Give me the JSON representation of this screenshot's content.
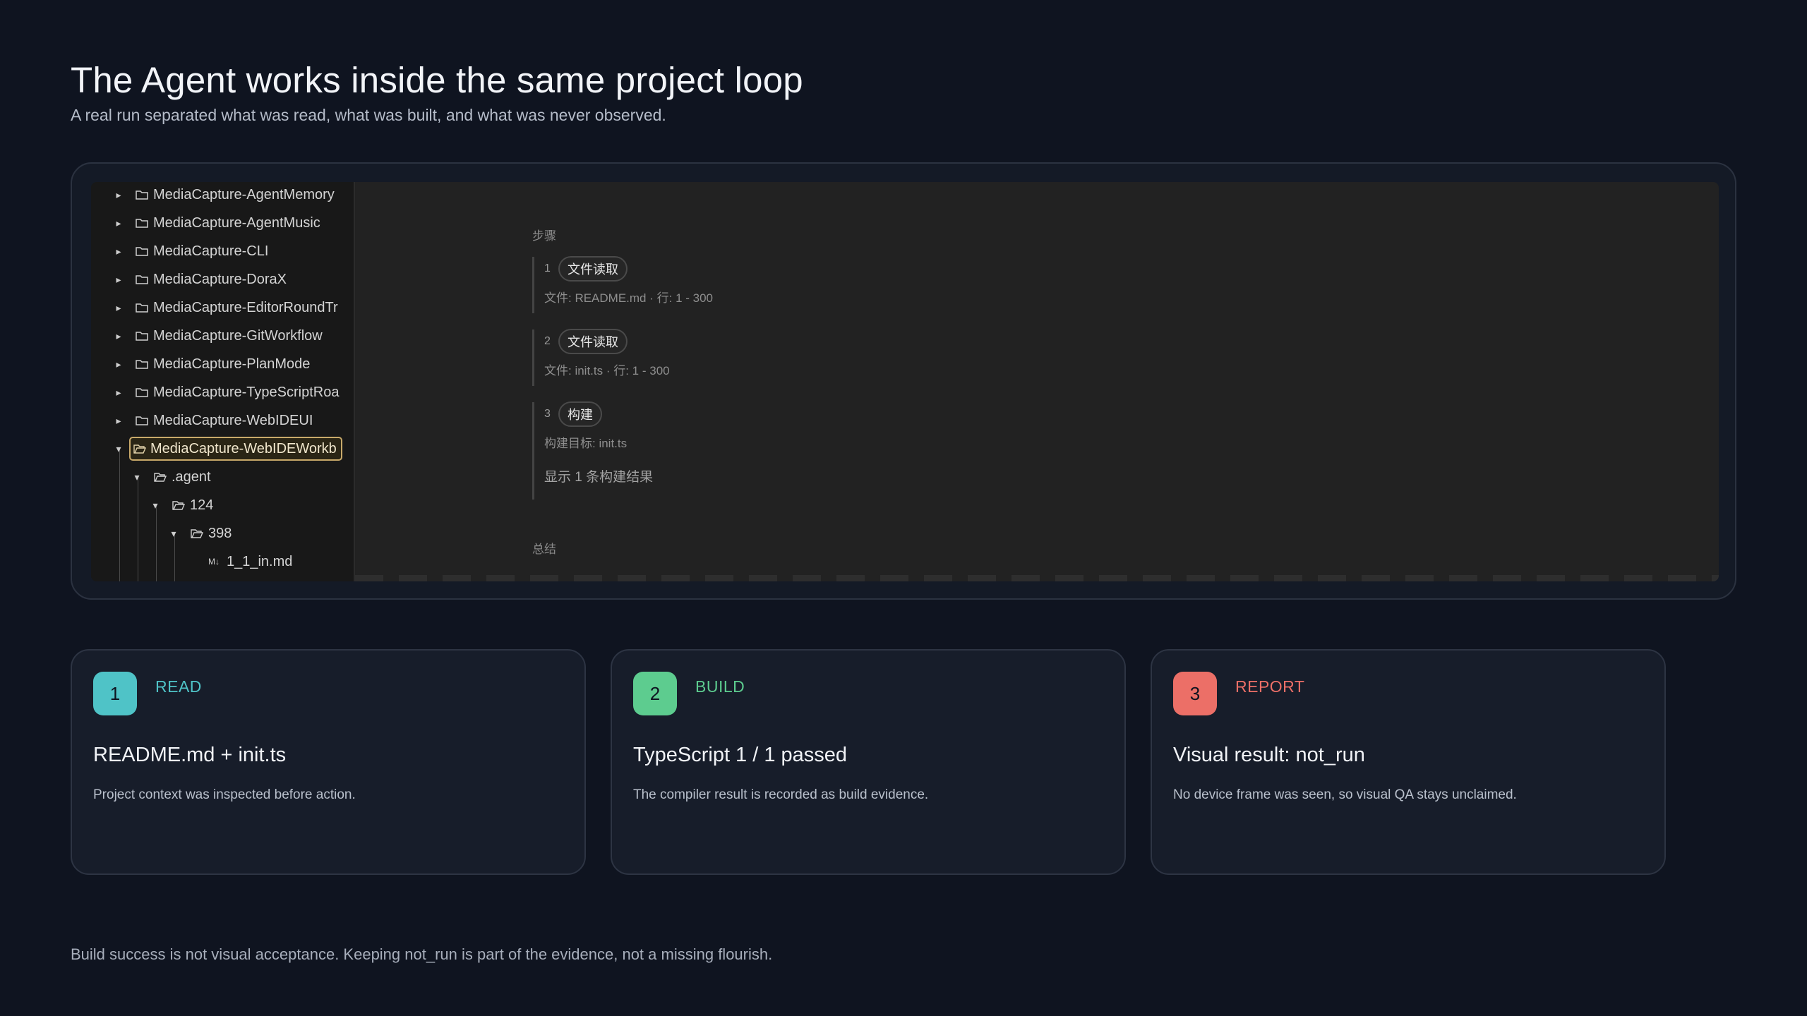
{
  "header": {
    "title": "The Agent works inside the same project loop",
    "subtitle": "A real run separated what was read, what was built, and what was never observed."
  },
  "explorer": {
    "items": [
      {
        "label": "MediaCapture-AgentMemory",
        "expanded": false
      },
      {
        "label": "MediaCapture-AgentMusic",
        "expanded": false
      },
      {
        "label": "MediaCapture-CLI",
        "expanded": false
      },
      {
        "label": "MediaCapture-DoraX",
        "expanded": false
      },
      {
        "label": "MediaCapture-EditorRoundTr",
        "expanded": false
      },
      {
        "label": "MediaCapture-GitWorkflow",
        "expanded": false
      },
      {
        "label": "MediaCapture-PlanMode",
        "expanded": false
      },
      {
        "label": "MediaCapture-TypeScriptRoa",
        "expanded": false
      },
      {
        "label": "MediaCapture-WebIDEUI",
        "expanded": false
      },
      {
        "label": "MediaCapture-WebIDEWorkb",
        "expanded": true,
        "selected": true
      },
      {
        "label": ".agent",
        "expanded": true
      },
      {
        "label": "124",
        "expanded": true
      },
      {
        "label": "398",
        "expanded": true
      },
      {
        "label": "1_1_in.md",
        "file_badge": "M↓"
      }
    ]
  },
  "run": {
    "steps_label": "步骤",
    "summary_label": "总结",
    "steps": [
      {
        "num": "1",
        "badge": "文件读取",
        "detail": "文件: README.md · 行: 1 - 300"
      },
      {
        "num": "2",
        "badge": "文件读取",
        "detail": "文件: init.ts · 行: 1 - 300"
      },
      {
        "num": "3",
        "badge": "构建",
        "detail": "构建目标: init.ts",
        "result": "显示 1 条构建结果"
      }
    ]
  },
  "cards": [
    {
      "num": "1",
      "kind": "READ",
      "title": "README.md + init.ts",
      "desc": "Project context was inspected before action.",
      "accent": "#4fc3c7"
    },
    {
      "num": "2",
      "kind": "BUILD",
      "title": "TypeScript 1 / 1 passed",
      "desc": "The compiler result is recorded as build evidence.",
      "accent": "#5dcc8f"
    },
    {
      "num": "3",
      "kind": "REPORT",
      "title": "Visual result: not_run",
      "desc": "No device frame was seen, so visual QA stays unclaimed.",
      "accent": "#ec6f67"
    }
  ],
  "footnote": "Build success is not visual acceptance. Keeping not_run is part of the evidence, not a missing flourish.",
  "colors": {
    "background": "#0f1420",
    "panel": "#141a26",
    "selection": "#c8a96a"
  },
  "icons": {
    "folder": "folder-icon",
    "folder_open": "folder-open-icon",
    "markdown": "markdown-file-icon",
    "collapsed": "chevron-right-icon",
    "expanded": "chevron-down-icon"
  }
}
